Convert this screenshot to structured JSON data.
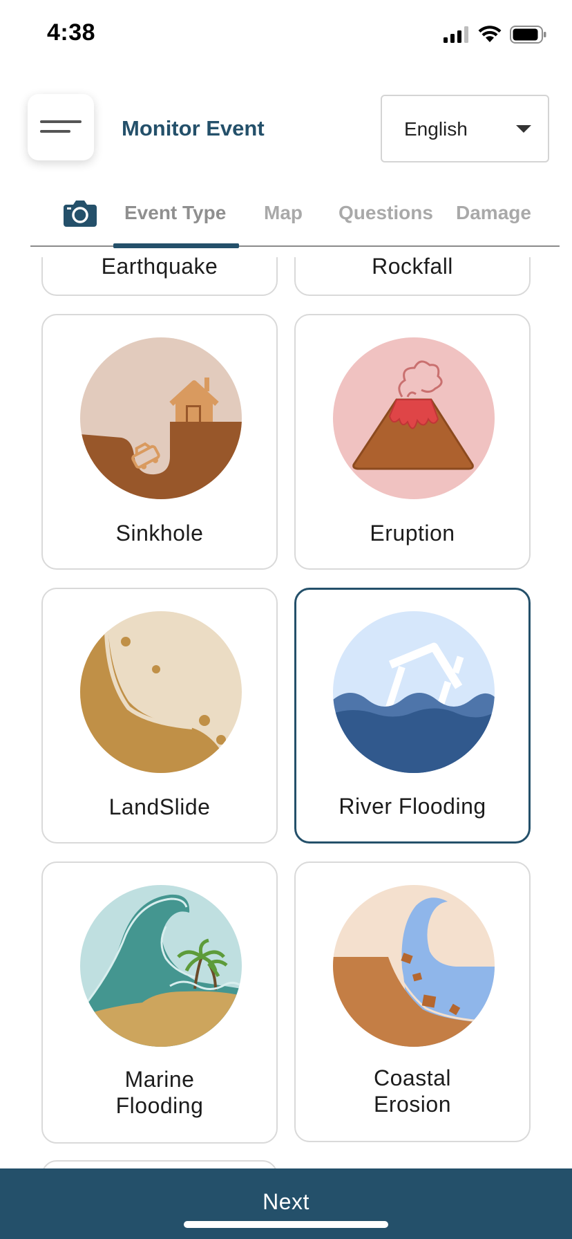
{
  "status_bar": {
    "time": "4:38"
  },
  "header": {
    "title": "Monitor Event",
    "language": {
      "selected": "English"
    }
  },
  "tabs": {
    "camera_icon": "camera-icon",
    "items": [
      {
        "label": "Event Type",
        "active": true
      },
      {
        "label": "Map",
        "active": false
      },
      {
        "label": "Questions",
        "active": false
      },
      {
        "label": "Damage",
        "active": false
      }
    ]
  },
  "event_types": {
    "partial_top": [
      "Earthquake",
      "Rockfall"
    ],
    "cards": [
      {
        "label": "Sinkhole",
        "icon": "sinkhole-icon",
        "selected": false
      },
      {
        "label": "Eruption",
        "icon": "eruption-icon",
        "selected": false
      },
      {
        "label": "LandSlide",
        "icon": "landslide-icon",
        "selected": false
      },
      {
        "label": "River Flooding",
        "icon": "river-flooding-icon",
        "selected": true
      },
      {
        "label_line1": "Marine",
        "label_line2": "Flooding",
        "icon": "marine-flooding-icon",
        "selected": false
      },
      {
        "label_line1": "Coastal",
        "label_line2": "Erosion",
        "icon": "coastal-erosion-icon",
        "selected": false
      }
    ]
  },
  "footer": {
    "next_label": "Next"
  },
  "colors": {
    "primary": "#24506a",
    "tab_inactive": "#a9a9a9",
    "card_border": "#d9d9d9"
  }
}
